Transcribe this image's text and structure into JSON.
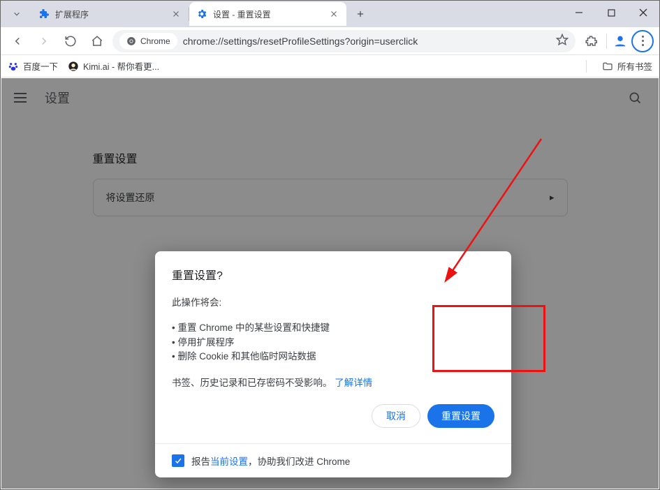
{
  "window": {
    "tabs": [
      {
        "label": "扩展程序",
        "active": false
      },
      {
        "label": "设置 - 重置设置",
        "active": true
      }
    ],
    "addr": {
      "chip": "Chrome",
      "url": "chrome://settings/resetProfileSettings?origin=userclick"
    },
    "bookmarks": [
      {
        "label": "百度一下"
      },
      {
        "label": "Kimi.ai - 帮你看更..."
      }
    ],
    "all_bookmarks": "所有书签"
  },
  "page": {
    "title": "设置",
    "section_title": "重置设置",
    "row_label": "将设置还原"
  },
  "dialog": {
    "title": "重置设置?",
    "subtitle": "此操作将会:",
    "bullets": [
      "重置 Chrome 中的某些设置和快捷键",
      "停用扩展程序",
      "删除 Cookie 和其他临时网站数据"
    ],
    "note_prefix": "书签、历史记录和已存密码不受影响。",
    "note_link": "了解详情",
    "cancel": "取消",
    "confirm": "重置设置",
    "report_prefix": "报告",
    "report_link": "当前设置",
    "report_suffix": "，协助我们改进 Chrome"
  }
}
